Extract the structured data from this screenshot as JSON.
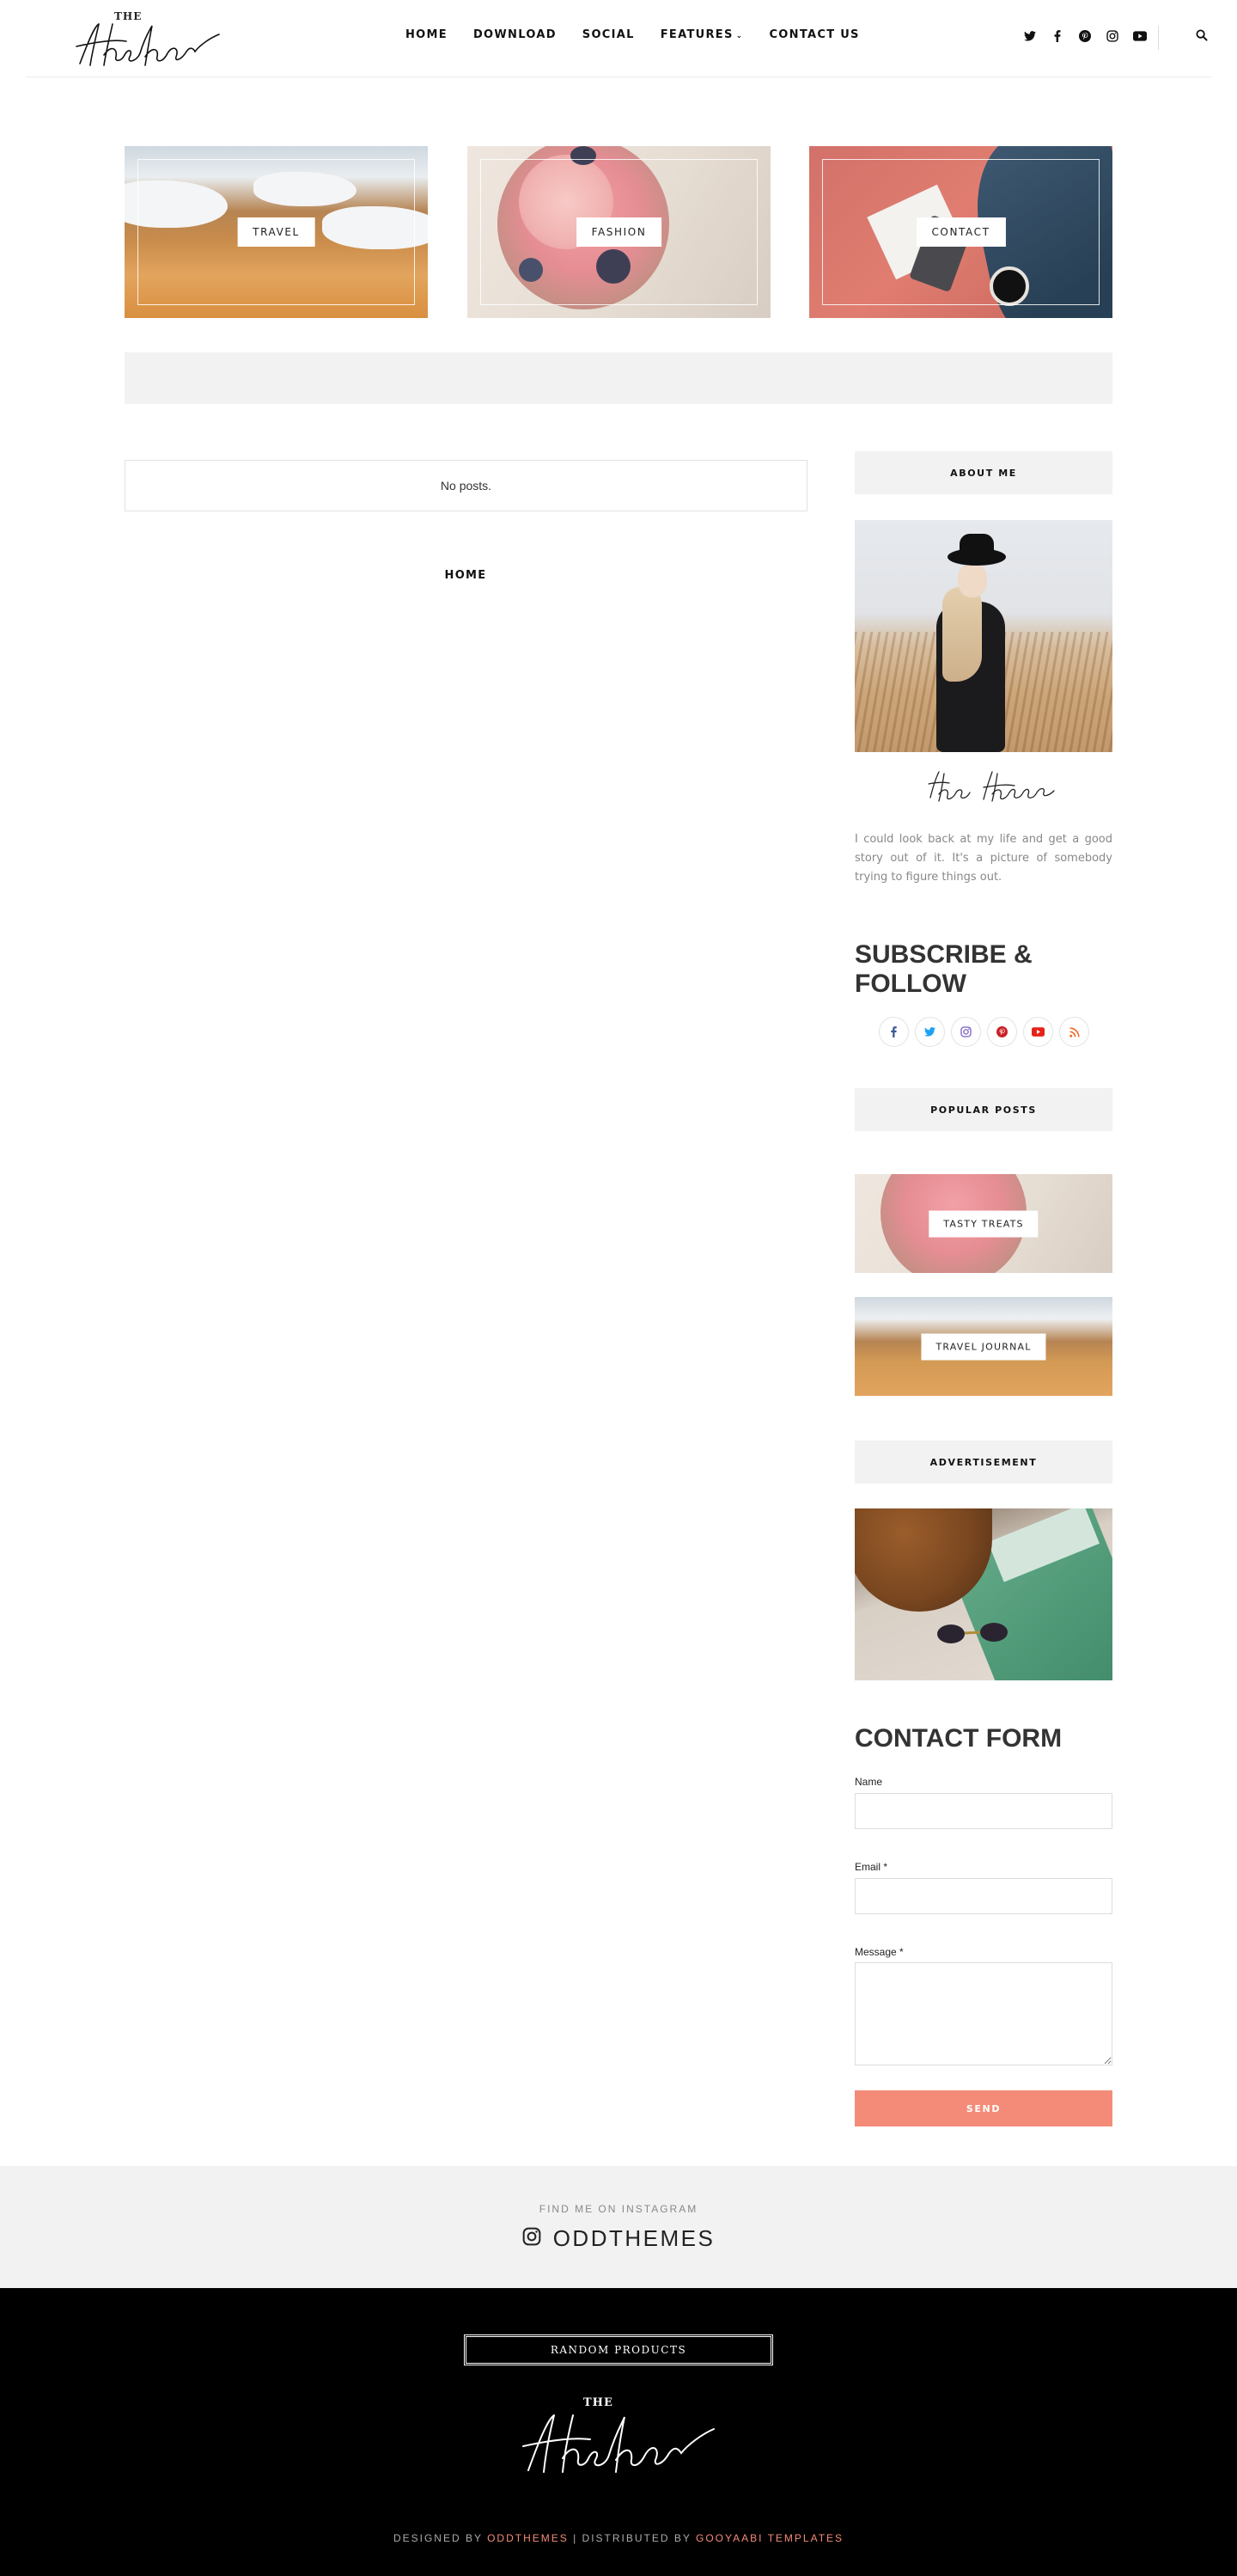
{
  "header": {
    "logo_the": "THE",
    "nav": [
      {
        "label": "HOME"
      },
      {
        "label": "DOWNLOAD"
      },
      {
        "label": "SOCIAL"
      },
      {
        "label": "FEATURES"
      },
      {
        "label": "CONTACT US"
      }
    ],
    "social_icons": [
      "twitter-icon",
      "facebook-icon",
      "pinterest-icon",
      "instagram-icon",
      "youtube-icon"
    ],
    "search_icon": "search-icon"
  },
  "featured": [
    {
      "label": "TRAVEL"
    },
    {
      "label": "FASHION"
    },
    {
      "label": "CONTACT"
    }
  ],
  "main": {
    "no_posts": "No posts.",
    "home_link": "HOME"
  },
  "sidebar": {
    "about_title": "ABOUT ME",
    "about_text": "I could look back at my life and get a good story out of it. It's a picture of somebody trying to figure things out.",
    "subscribe_title": "SUBSCRIBE & FOLLOW",
    "follow_icons": [
      "facebook-icon",
      "twitter-icon",
      "instagram-icon",
      "pinterest-icon",
      "youtube-icon",
      "rss-icon"
    ],
    "popular_title": "POPULAR POSTS",
    "popular": [
      {
        "label": "TASTY TREATS"
      },
      {
        "label": "TRAVEL JOURNAL"
      }
    ],
    "ad_title": "ADVERTISEMENT",
    "contact_title": "CONTACT FORM",
    "form": {
      "name_label": "Name",
      "email_label": "Email *",
      "message_label": "Message *",
      "send_label": "SEND"
    }
  },
  "instagram": {
    "find": "FIND ME ON INSTAGRAM",
    "handle": "ODDTHEMES"
  },
  "footer": {
    "random_products": "RANDOM PRODUCTS",
    "logo_the": "THE",
    "designed_by": "DESIGNED BY ",
    "oddthemes": "ODDTHEMES",
    "distributed_by": " | DISTRIBUTED BY ",
    "gooyaabi": "GOOYAABI TEMPLATES"
  },
  "colors": {
    "accent": "#f48b78",
    "footer_bg": "#000000",
    "panel_bg": "#f2f2f2"
  }
}
